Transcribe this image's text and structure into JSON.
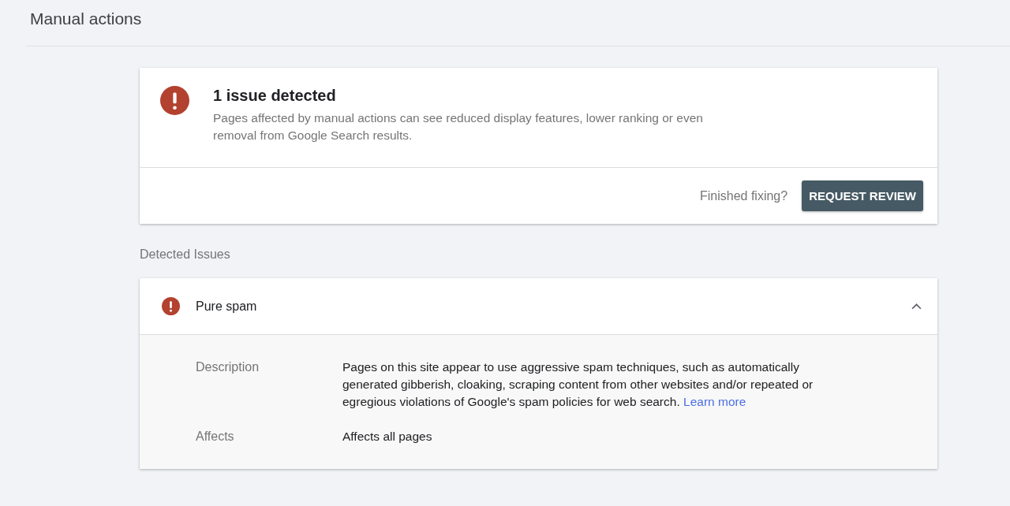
{
  "page_title": "Manual actions",
  "summary": {
    "title": "1 issue detected",
    "text": "Pages affected by manual actions can see reduced display features, lower ranking or even removal from Google Search results.",
    "footer_prompt": "Finished fixing?",
    "button": "REQUEST REVIEW"
  },
  "section_label": "Detected Issues",
  "issues": [
    {
      "name": "Pure spam",
      "expanded": true,
      "details": [
        {
          "label": "Description",
          "text": "Pages on this site appear to use aggressive spam techniques, such as automatically generated gibberish, cloaking, scraping content from other websites and/or repeated or egregious violations of Google's spam policies for web search.",
          "link": "Learn more"
        },
        {
          "label": "Affects",
          "text": "Affects all pages"
        }
      ]
    }
  ]
}
